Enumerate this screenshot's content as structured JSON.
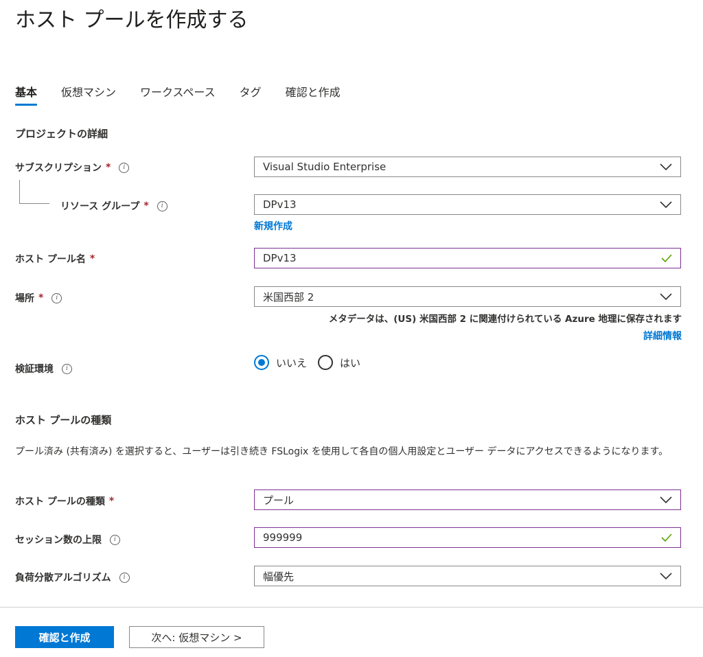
{
  "page": {
    "title": "ホスト プールを作成する"
  },
  "tabs": [
    {
      "label": "基本",
      "active": true
    },
    {
      "label": "仮想マシン"
    },
    {
      "label": "ワークスペース"
    },
    {
      "label": "タグ"
    },
    {
      "label": "確認と作成"
    }
  ],
  "project": {
    "section_title": "プロジェクトの詳細",
    "subscription": {
      "label": "サブスクリプション",
      "required": "*",
      "value": "Visual Studio Enterprise"
    },
    "resource_group": {
      "label": "リソース グループ",
      "required": "*",
      "value": "DPv13",
      "create_new": "新規作成"
    },
    "host_pool_name": {
      "label": "ホスト プール名",
      "required": "*",
      "value": "DPv13"
    },
    "location": {
      "label": "場所",
      "required": "*",
      "value": "米国西部 2",
      "note": "メタデータは、(US) 米国西部 2 に関連付けられている Azure 地理に保存されます",
      "learn_more": "詳細情報"
    },
    "validation_env": {
      "label": "検証環境",
      "option_no": "いいえ",
      "option_yes": "はい",
      "selected": "いいえ"
    }
  },
  "host_pool_type": {
    "section_title": "ホスト プールの種類",
    "description": "プール済み (共有済み) を選択すると、ユーザーは引き続き FSLogix を使用して各自の個人用設定とユーザー データにアクセスできるようになります。",
    "type": {
      "label": "ホスト プールの種類",
      "required": "*",
      "value": "プール"
    },
    "max_sessions": {
      "label": "セッション数の上限",
      "value": "999999"
    },
    "load_balancing": {
      "label": "負荷分散アルゴリズム",
      "value": "幅優先"
    }
  },
  "footer": {
    "review_create": "確認と作成",
    "next": "次へ: 仮想マシン >"
  },
  "colors": {
    "accent": "#0078d4",
    "required": "#a4262c",
    "valid": "#57a300",
    "focus_border": "#7b2f91"
  },
  "icons": {
    "info": "info-icon",
    "dropdown": "chevron-down-icon",
    "valid": "checkmark-icon"
  }
}
